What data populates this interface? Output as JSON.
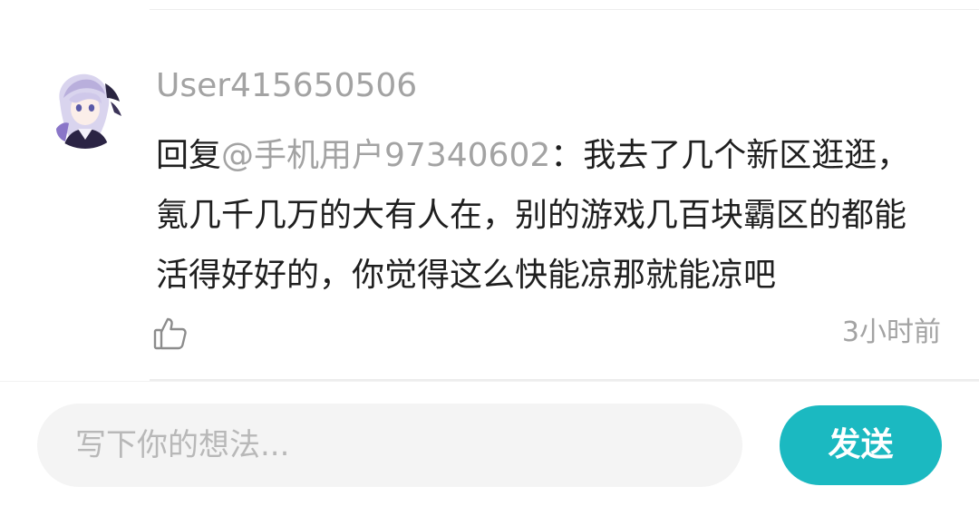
{
  "comment": {
    "username": "User415650506",
    "reply_prefix": "回复",
    "mention": "@手机用户97340602",
    "text": "：我去了几个新区逛逛，氪几千几万的大有人在，别的游戏几百块霸区的都能活得好好的，你觉得这么快能凉那就能凉吧",
    "timestamp": "3小时前",
    "avatar_icon": "anime-avatar",
    "like_icon": "thumbs-up-icon"
  },
  "input_bar": {
    "placeholder": "写下你的想法...",
    "send_label": "发送"
  },
  "colors": {
    "accent": "#1bb9c1",
    "muted_text": "#a3a3a3",
    "body_text": "#1f1f1f",
    "input_bg": "#f4f4f4"
  }
}
